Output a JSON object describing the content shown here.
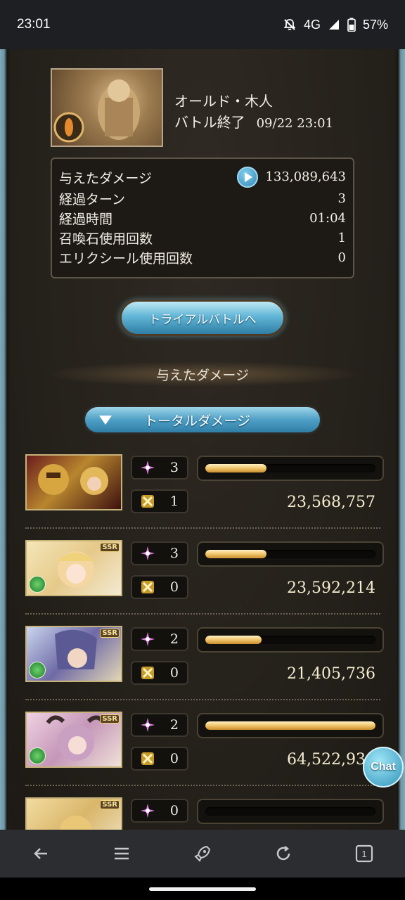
{
  "status_bar": {
    "time": "23:01",
    "network": "4G",
    "battery": "57%"
  },
  "battle": {
    "boss_name": "オールド・木人",
    "result_label": "バトル終了",
    "date": "09/22 23:01",
    "stats": [
      {
        "label": "与えたダメージ",
        "value": "133,089,643"
      },
      {
        "label": "経過ターン",
        "value": "3"
      },
      {
        "label": "経過時間",
        "value": "01:04"
      },
      {
        "label": "召喚石使用回数",
        "value": "1"
      },
      {
        "label": "エリクシール使用回数",
        "value": "0"
      }
    ],
    "trial_button": "トライアルバトルへ",
    "section_title": "与えたダメージ",
    "total_button": "トータルダメージ"
  },
  "members": [
    {
      "ougi": "3",
      "debuff": "1",
      "damage": "23,568,757",
      "bar_fraction": 0.36,
      "ssr": "",
      "element": ""
    },
    {
      "ougi": "3",
      "debuff": "0",
      "damage": "23,592,214",
      "bar_fraction": 0.36,
      "ssr": "SSR",
      "element": "wind"
    },
    {
      "ougi": "2",
      "debuff": "0",
      "damage": "21,405,736",
      "bar_fraction": 0.33,
      "ssr": "SSR",
      "element": "wind"
    },
    {
      "ougi": "2",
      "debuff": "0",
      "damage": "64,522,936",
      "bar_fraction": 1.0,
      "ssr": "SSR",
      "element": "wind"
    },
    {
      "ougi": "0",
      "debuff": "",
      "damage": "",
      "bar_fraction": 0.0,
      "ssr": "SSR",
      "element": ""
    }
  ],
  "chat_label": "Chat",
  "nav": {
    "tab_count": "1"
  },
  "colors": {
    "bar_fill": "#f0c56a",
    "button_blue": "#4e9fc6",
    "ougi_pink": "#e27be8"
  }
}
